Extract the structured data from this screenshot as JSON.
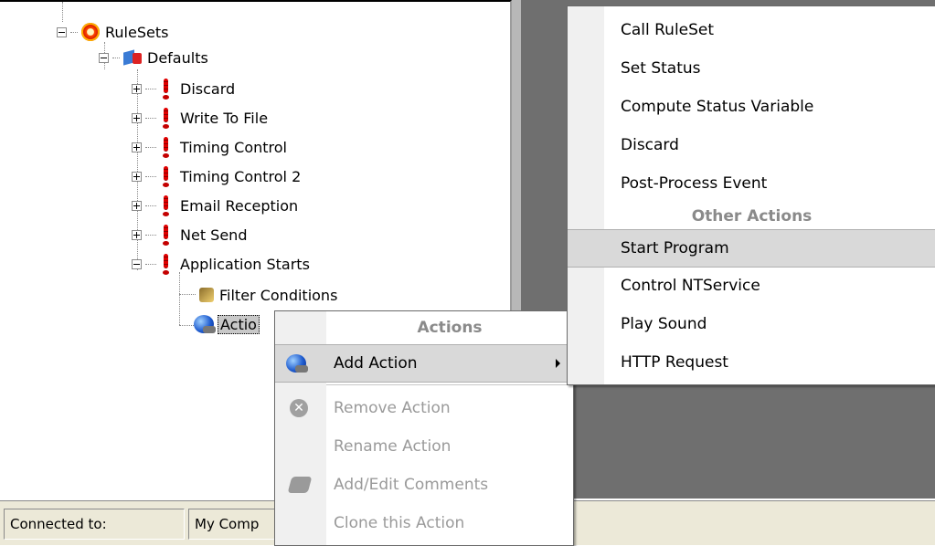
{
  "tree": {
    "root": "RuleSets",
    "defaults": "Defaults",
    "items": [
      "Discard",
      "Write To File",
      "Timing Control",
      "Timing Control 2",
      "Email Reception",
      "Net Send",
      "Application Starts"
    ],
    "children": {
      "filter": "Filter Conditions",
      "actions": "Actio"
    }
  },
  "status_bar": {
    "connected_label": "Connected to:",
    "computer": "My Comp"
  },
  "context_menu": {
    "header": "Actions",
    "add_action": "Add Action",
    "remove_action": "Remove Action",
    "rename_action": "Rename Action",
    "comments": "Add/Edit Comments",
    "clone": "Clone this Action"
  },
  "submenu": {
    "items_top": [
      "Call RuleSet",
      "Set Status",
      "Compute Status Variable",
      "Discard",
      "Post-Process Event"
    ],
    "other_header": "Other Actions",
    "items_other": [
      "Start Program",
      "Control NTService",
      "Play Sound",
      "HTTP Request"
    ],
    "highlighted": "Start Program"
  }
}
